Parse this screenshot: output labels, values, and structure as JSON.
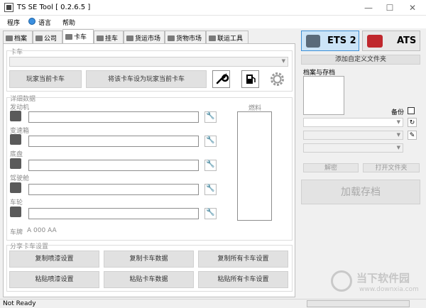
{
  "window": {
    "title": "TS SE Tool [ 0.2.6.5 ]",
    "minimize": "—",
    "maximize": "☐",
    "close": "✕"
  },
  "menu": [
    "程序",
    "语言",
    "帮助"
  ],
  "tabs": [
    "档案",
    "公司",
    "卡车",
    "挂车",
    "货运市场",
    "货物市场",
    "联运工具"
  ],
  "truck": {
    "group_label": "卡车",
    "player_truck_btn": "玩家当前卡车",
    "set_player_truck_btn": "将该卡车设为玩家当前卡车"
  },
  "details": {
    "group_label": "详细数据",
    "fuel_label": "燃料",
    "parts": [
      "发动机",
      "变速箱",
      "底盘",
      "驾驶舱",
      "车轮"
    ],
    "plate_label": "车牌",
    "plate_value": "A 000 AA"
  },
  "share": {
    "group_label": "分享卡车设置",
    "row1": [
      "复制喷漆设置",
      "复制卡车数据",
      "复制所有卡车设置"
    ],
    "row2": [
      "粘贴喷漆设置",
      "粘贴卡车数据",
      "粘贴所有卡车设置"
    ]
  },
  "right": {
    "ets2_label": "ETS 2",
    "ats_label": "ATS",
    "add_folder_btn": "添加自定义文件夹",
    "profiles_label": "档案与存档",
    "backup_label": "备份",
    "decrypt_btn": "解密",
    "open_folder_btn": "打开文件夹",
    "load_save_btn": "加载存档"
  },
  "watermark": {
    "brand": "当下软件园",
    "url": "www.downxia.com"
  },
  "status": {
    "text": "Not Ready"
  }
}
